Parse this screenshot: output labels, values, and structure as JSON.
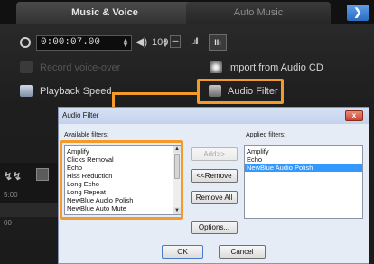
{
  "tabs": {
    "active": "Music & Voice",
    "inactive": "Auto Music",
    "menu_glyph": "❯"
  },
  "toolbar": {
    "timecode": "0:00:07.00",
    "volume": "100",
    "meter_glyph": "..ıll",
    "bars_glyph": "llı"
  },
  "panel": {
    "record_voiceover": "Record voice-over",
    "import_cd": "Import from Audio CD",
    "playback_speed": "Playback Speed",
    "audio_filter": "Audio Filter"
  },
  "timeline": {
    "wave_glyph": "↯↯",
    "time_top": "5:00",
    "time_bottom": "00"
  },
  "dialog": {
    "title": "Audio Filter",
    "close_label": "x",
    "available_label": "Available filters:",
    "applied_label": "Applied filters:",
    "available_filters": [
      "Amplify",
      "Clicks Removal",
      "Echo",
      "Hiss Reduction",
      "Long Echo",
      "Long Repeat",
      "NewBlue Audio Polish",
      "NewBlue Auto Mute"
    ],
    "applied_filters": [
      "Amplify",
      "Echo",
      "NewBlue Audio Polish"
    ],
    "buttons": {
      "add": "Add>>",
      "remove": "<<Remove",
      "remove_all": "Remove All",
      "options": "Options...",
      "ok": "OK",
      "cancel": "Cancel"
    }
  },
  "colors": {
    "highlight_orange": "#f39a2a",
    "selection_blue": "#3399ff",
    "dark_bg": "#1e1e1e"
  }
}
